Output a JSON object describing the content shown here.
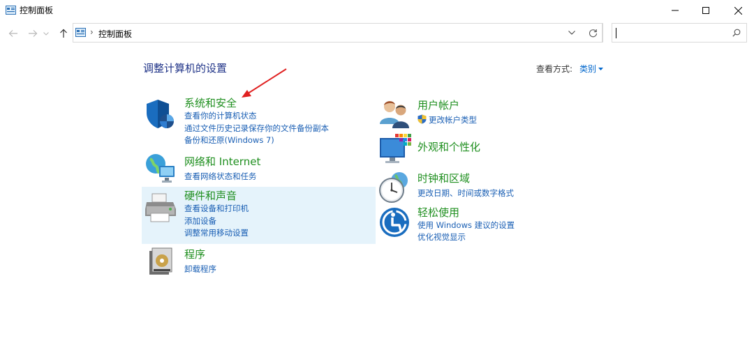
{
  "window": {
    "title": "控制面板"
  },
  "address": {
    "breadcrumb": "控制面板",
    "search_value": ""
  },
  "header": {
    "page_title": "调整计算机的设置",
    "view_label": "查看方式:",
    "view_value": "类别"
  },
  "categories": [
    {
      "title": "系统和安全",
      "icon": "security-shield-icon",
      "links": [
        "查看你的计算机状态",
        "通过文件历史记录保存你的文件备份副本",
        "备份和还原(Windows 7)"
      ]
    },
    {
      "title": "网络和 Internet",
      "icon": "network-globe-icon",
      "links": [
        "查看网络状态和任务"
      ]
    },
    {
      "title": "硬件和声音",
      "icon": "printer-icon",
      "links": [
        "查看设备和打印机",
        "添加设备",
        "调整常用移动设置"
      ]
    },
    {
      "title": "程序",
      "icon": "programs-disk-icon",
      "links": [
        "卸载程序"
      ]
    },
    {
      "title": "用户帐户",
      "icon": "users-icon",
      "links": [
        "更改帐户类型"
      ]
    },
    {
      "title": "外观和个性化",
      "icon": "appearance-monitor-icon",
      "links": []
    },
    {
      "title": "时钟和区域",
      "icon": "clock-globe-icon",
      "links": [
        "更改日期、时间或数字格式"
      ]
    },
    {
      "title": "轻松使用",
      "icon": "ease-of-access-icon",
      "links": [
        "使用 Windows 建议的设置",
        "优化视觉显示"
      ]
    }
  ],
  "colors": {
    "category_title": "#1f8f1f",
    "link": "#1a5fb4",
    "page_title": "#1e3287",
    "highlight": "#e5f3fb",
    "annotation_arrow": "#e02020"
  }
}
